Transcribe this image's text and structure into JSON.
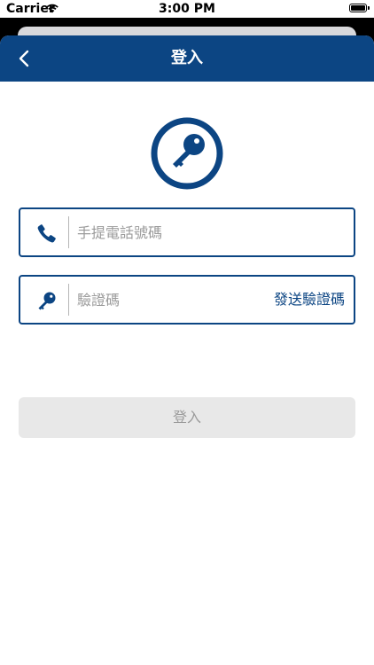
{
  "status_bar": {
    "carrier": "Carrier",
    "time": "3:00 PM"
  },
  "navbar": {
    "title": "登入",
    "back_icon": "chevron-left-icon"
  },
  "form": {
    "phone": {
      "icon": "phone-icon",
      "placeholder": "手提電話號碼",
      "value": ""
    },
    "code": {
      "icon": "key-icon",
      "placeholder": "驗證碼",
      "value": "",
      "send_code_label": "發送驗證碼"
    }
  },
  "login_button": {
    "label": "登入",
    "enabled": false
  },
  "colors": {
    "primary": "#0c4583",
    "disabled_button_bg": "#e8e8e8",
    "disabled_button_text": "#9b9b9b",
    "placeholder": "#9a9a9a"
  }
}
